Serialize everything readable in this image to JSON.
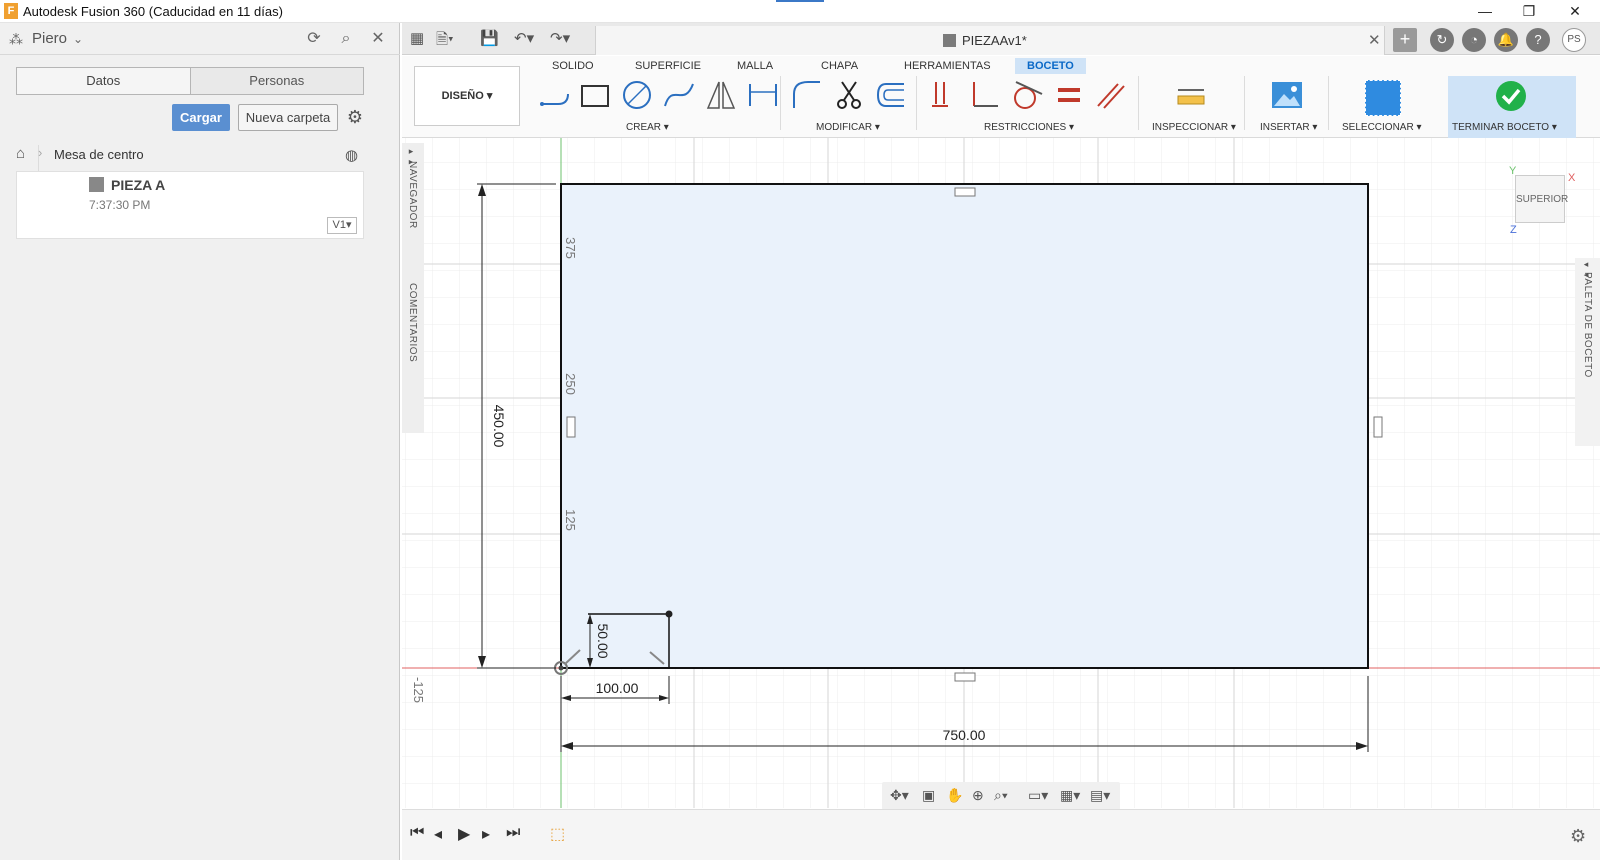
{
  "window": {
    "title": "Autodesk Fusion 360 (Caducidad en 11 días)",
    "minimize": "—",
    "maximize": "❐",
    "close": "✕"
  },
  "left_panel": {
    "user": "Piero",
    "tabs": [
      "Datos",
      "Personas"
    ],
    "upload_label": "Cargar",
    "new_folder_label": "Nueva carpeta",
    "breadcrumb": "Mesa de centro",
    "file": {
      "name": "PIEZA A",
      "time": "7:37:30 PM",
      "version": "V1▾"
    }
  },
  "document": {
    "tab_name": "PIEZAAv1*",
    "user_initials": "PS"
  },
  "toolbar": {
    "workspace": "DISEÑO ▾",
    "tabs": [
      "SOLIDO",
      "SUPERFICIE",
      "MALLA",
      "CHAPA",
      "HERRAMIENTAS",
      "BOCETO"
    ],
    "active_tab": "BOCETO",
    "groups": [
      "CREAR ▾",
      "MODIFICAR ▾",
      "RESTRICCIONES ▾",
      "INSPECCIONAR ▾",
      "INSERTAR ▾",
      "SELECCIONAR ▾",
      "TERMINAR BOCETO ▾"
    ]
  },
  "side_labels": {
    "navegador": "NAVEGADOR",
    "comentarios": "COMENTARIOS",
    "paleta": "PALETA DE BOCETO"
  },
  "viewcube": {
    "face": "SUPERIOR",
    "x": "X",
    "y": "Y",
    "z": "Z"
  },
  "sketch": {
    "ruler_labels": [
      "375",
      "250",
      "125",
      "-125"
    ],
    "dim_height": "450.00",
    "dim_width": "750.00",
    "dim_small_w": "100.00",
    "dim_small_h": "50.00"
  },
  "colors": {
    "accent": "#0b69c7",
    "sketch_fill": "#eaf2fb",
    "axis_red": "#e06060",
    "axis_green": "#6cc26c",
    "check_green": "#21b14a"
  }
}
